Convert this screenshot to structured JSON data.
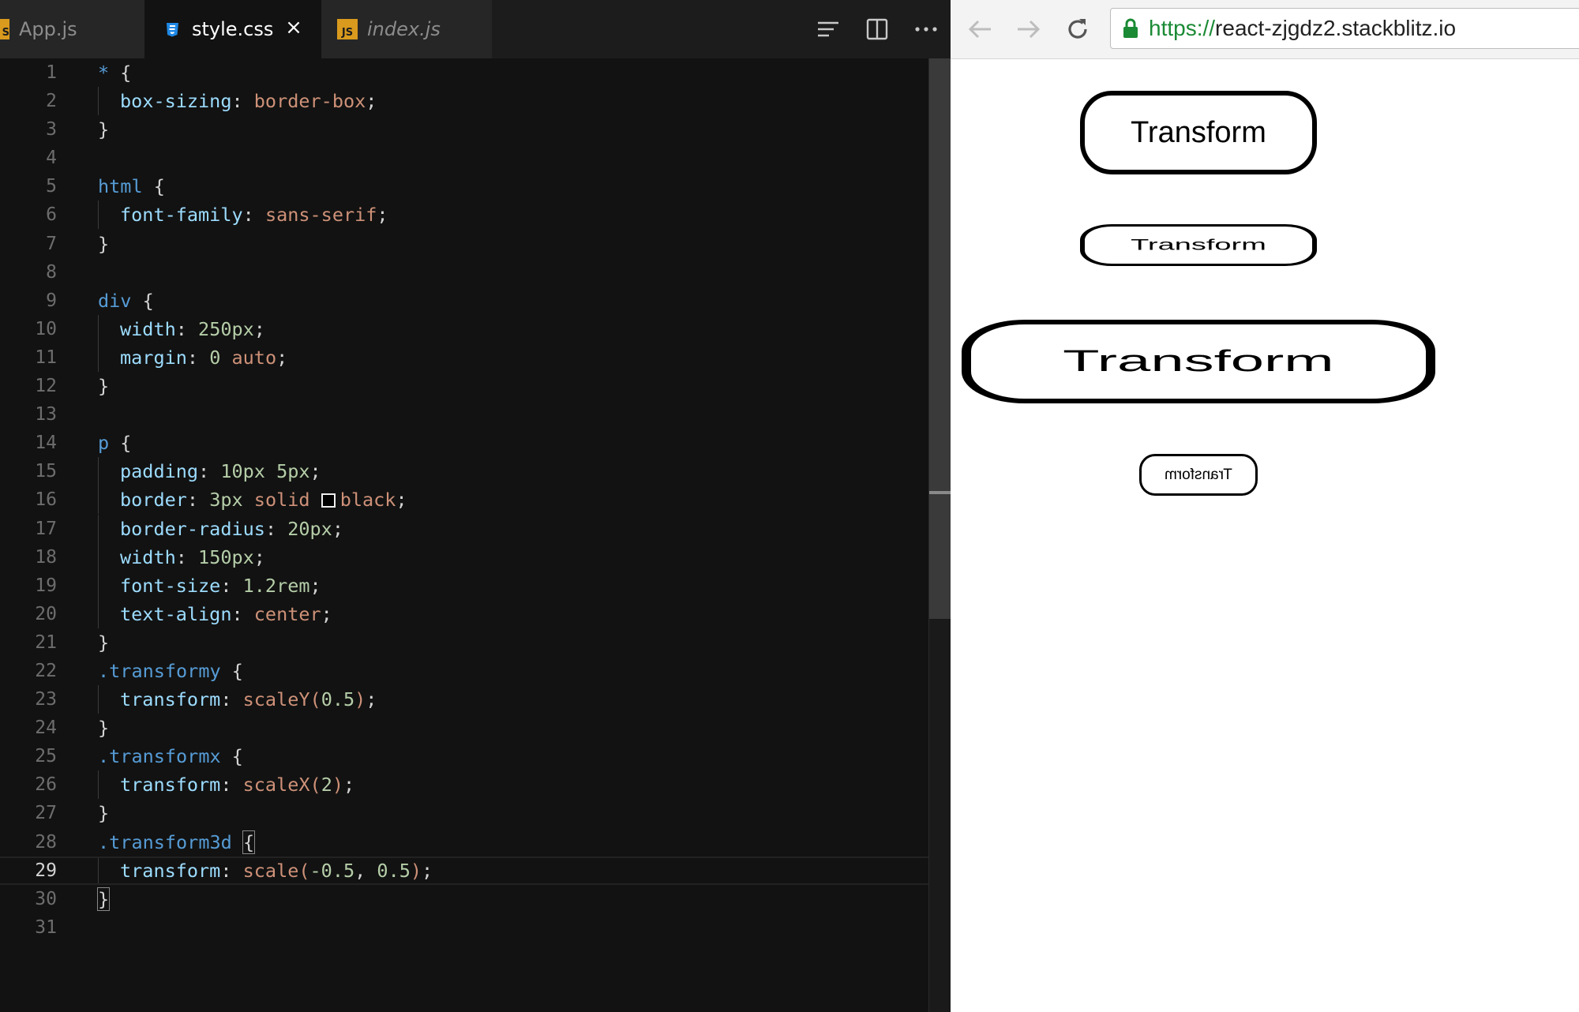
{
  "editor": {
    "tabs": [
      {
        "label": "App.js",
        "icon": "js-file-icon"
      },
      {
        "label": "style.css",
        "icon": "css-file-icon",
        "active": true
      },
      {
        "label": "index.js",
        "icon": "js-file-icon"
      }
    ],
    "close_glyph": "×",
    "js_badge": "JS",
    "active_line": 29,
    "line_numbers": [
      "1",
      "2",
      "3",
      "4",
      "5",
      "6",
      "7",
      "8",
      "9",
      "10",
      "11",
      "12",
      "13",
      "14",
      "15",
      "16",
      "17",
      "18",
      "19",
      "20",
      "21",
      "22",
      "23",
      "24",
      "25",
      "26",
      "27",
      "28",
      "29",
      "30",
      "31"
    ],
    "colors": {
      "background": "#121212",
      "selector": "#569cd6",
      "property": "#9cdcfe",
      "value": "#ce9178",
      "number": "#b5cea8"
    }
  },
  "code": {
    "l1": {
      "sel": "*",
      "brace": " {"
    },
    "l2": {
      "prop": "box-sizing",
      "val": "border-box"
    },
    "l3": "}",
    "l5": {
      "sel": "html",
      "brace": " {"
    },
    "l6": {
      "prop": "font-family",
      "val": "sans-serif"
    },
    "l7": "}",
    "l9": {
      "sel": "div",
      "brace": " {"
    },
    "l10": {
      "prop": "width",
      "val": "250px"
    },
    "l11": {
      "prop": "margin",
      "num": "0",
      "val": "auto"
    },
    "l12": "}",
    "l14": {
      "sel": "p",
      "brace": " {"
    },
    "l15": {
      "prop": "padding",
      "val1": "10px",
      "val2": "5px"
    },
    "l16": {
      "prop": "border",
      "num": "3px",
      "kw": "solid",
      "color": "black"
    },
    "l17": {
      "prop": "border-radius",
      "val": "20px"
    },
    "l18": {
      "prop": "width",
      "val": "150px"
    },
    "l19": {
      "prop": "font-size",
      "val": "1.2rem"
    },
    "l20": {
      "prop": "text-align",
      "val": "center"
    },
    "l21": "}",
    "l22": {
      "sel": ".transformy",
      "brace": " {"
    },
    "l23": {
      "prop": "transform",
      "fn": "scaleY(",
      "arg": "0.5",
      "close": ")"
    },
    "l24": "}",
    "l25": {
      "sel": ".transformx",
      "brace": " {"
    },
    "l26": {
      "prop": "transform",
      "fn": "scaleX(",
      "arg": "2",
      "close": ")"
    },
    "l27": "}",
    "l28": {
      "sel": ".transform3d",
      "brace": "{"
    },
    "l29": {
      "prop": "transform",
      "fn": "scale(",
      "arg1": "-0.5",
      "arg2": "0.5",
      "close": ")"
    },
    "l30": "}"
  },
  "browser": {
    "url_scheme": "https://",
    "url_host": "react-zjgdz2.stackblitz.io",
    "demo_text": [
      "Transform",
      "Transform",
      "Transform",
      "Transform"
    ]
  }
}
